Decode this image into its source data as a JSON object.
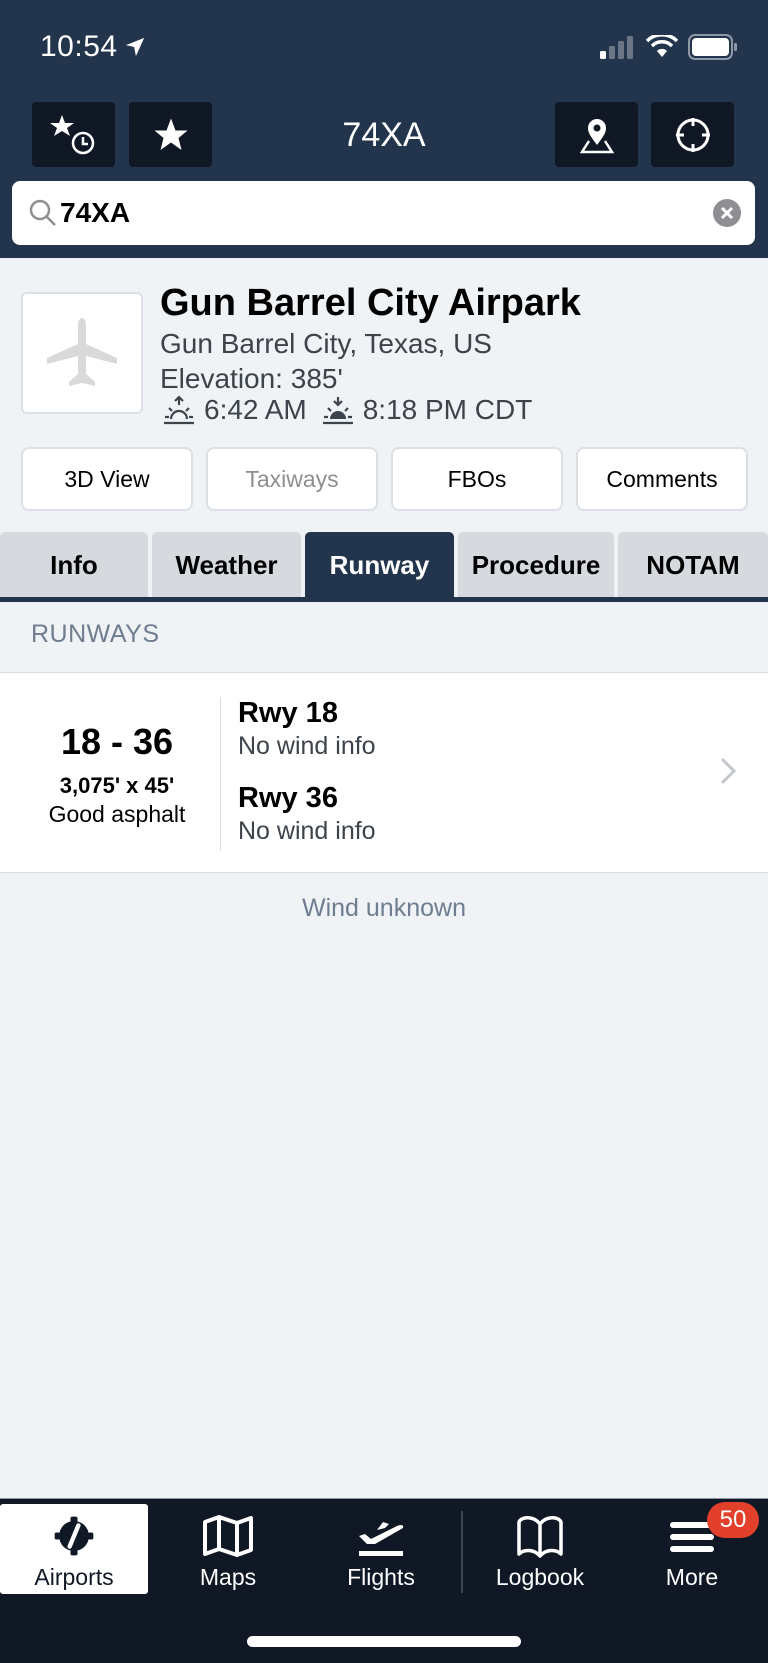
{
  "status_bar": {
    "time": "10:54"
  },
  "nav": {
    "title": "74XA",
    "buttons": [
      {
        "name": "recent-favorites",
        "icon": "star-clock-icon"
      },
      {
        "name": "favorites",
        "icon": "star-icon"
      },
      {
        "name": "map-location",
        "icon": "map-pin-icon"
      },
      {
        "name": "nearest",
        "icon": "crosshair-icon"
      }
    ]
  },
  "search": {
    "value": "74XA",
    "placeholder": "Search"
  },
  "airport": {
    "name": "Gun Barrel City Airpark",
    "location": "Gun Barrel City, Texas, US",
    "elevation": "Elevation: 385'",
    "sunrise": "6:42 AM",
    "sunset": "8:18 PM CDT"
  },
  "actions": [
    {
      "label": "3D View",
      "enabled": true
    },
    {
      "label": "Taxiways",
      "enabled": false
    },
    {
      "label": "FBOs",
      "enabled": true
    },
    {
      "label": "Comments",
      "enabled": true
    }
  ],
  "tabs": [
    {
      "label": "Info",
      "active": false
    },
    {
      "label": "Weather",
      "active": false
    },
    {
      "label": "Runway",
      "active": true
    },
    {
      "label": "Procedure",
      "active": false
    },
    {
      "label": "NOTAM",
      "active": false
    }
  ],
  "runways": {
    "section_title": "RUNWAYS",
    "items": [
      {
        "id": "18 - 36",
        "dimensions": "3,075' x 45'",
        "surface": "Good asphalt",
        "ends": [
          {
            "name": "Rwy 18",
            "wind": "No wind info"
          },
          {
            "name": "Rwy 36",
            "wind": "No wind info"
          }
        ]
      }
    ],
    "footer": "Wind unknown"
  },
  "tabbar": {
    "items": [
      {
        "label": "Airports",
        "active": true
      },
      {
        "label": "Maps",
        "active": false
      },
      {
        "label": "Flights",
        "active": false
      },
      {
        "label": "Logbook",
        "active": false
      },
      {
        "label": "More",
        "active": false,
        "badge": "50"
      }
    ]
  },
  "colors": {
    "nav_bg": "#23344d",
    "button_bg": "#111825",
    "badge": "#e2402b",
    "page_bg": "#eff3f6"
  }
}
